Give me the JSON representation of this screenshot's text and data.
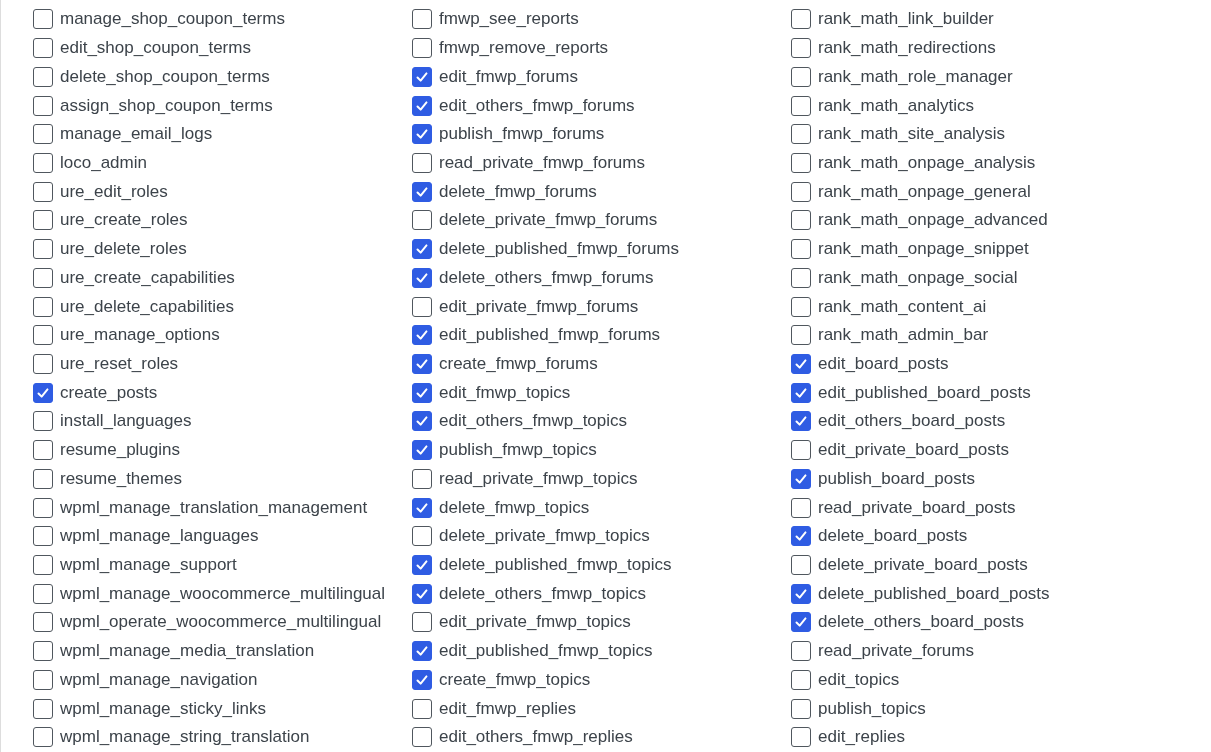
{
  "columns": [
    [
      {
        "label": "manage_shop_coupon_terms",
        "checked": false
      },
      {
        "label": "edit_shop_coupon_terms",
        "checked": false
      },
      {
        "label": "delete_shop_coupon_terms",
        "checked": false
      },
      {
        "label": "assign_shop_coupon_terms",
        "checked": false
      },
      {
        "label": "manage_email_logs",
        "checked": false
      },
      {
        "label": "loco_admin",
        "checked": false
      },
      {
        "label": "ure_edit_roles",
        "checked": false
      },
      {
        "label": "ure_create_roles",
        "checked": false
      },
      {
        "label": "ure_delete_roles",
        "checked": false
      },
      {
        "label": "ure_create_capabilities",
        "checked": false
      },
      {
        "label": "ure_delete_capabilities",
        "checked": false
      },
      {
        "label": "ure_manage_options",
        "checked": false
      },
      {
        "label": "ure_reset_roles",
        "checked": false
      },
      {
        "label": "create_posts",
        "checked": true
      },
      {
        "label": "install_languages",
        "checked": false
      },
      {
        "label": "resume_plugins",
        "checked": false
      },
      {
        "label": "resume_themes",
        "checked": false
      },
      {
        "label": "wpml_manage_translation_management",
        "checked": false
      },
      {
        "label": "wpml_manage_languages",
        "checked": false
      },
      {
        "label": "wpml_manage_support",
        "checked": false
      },
      {
        "label": "wpml_manage_woocommerce_multilingual",
        "checked": false
      },
      {
        "label": "wpml_operate_woocommerce_multilingual",
        "checked": false
      },
      {
        "label": "wpml_manage_media_translation",
        "checked": false
      },
      {
        "label": "wpml_manage_navigation",
        "checked": false
      },
      {
        "label": "wpml_manage_sticky_links",
        "checked": false
      },
      {
        "label": "wpml_manage_string_translation",
        "checked": false
      }
    ],
    [
      {
        "label": "fmwp_see_reports",
        "checked": false
      },
      {
        "label": "fmwp_remove_reports",
        "checked": false
      },
      {
        "label": "edit_fmwp_forums",
        "checked": true
      },
      {
        "label": "edit_others_fmwp_forums",
        "checked": true
      },
      {
        "label": "publish_fmwp_forums",
        "checked": true
      },
      {
        "label": "read_private_fmwp_forums",
        "checked": false
      },
      {
        "label": "delete_fmwp_forums",
        "checked": true
      },
      {
        "label": "delete_private_fmwp_forums",
        "checked": false
      },
      {
        "label": "delete_published_fmwp_forums",
        "checked": true
      },
      {
        "label": "delete_others_fmwp_forums",
        "checked": true
      },
      {
        "label": "edit_private_fmwp_forums",
        "checked": false
      },
      {
        "label": "edit_published_fmwp_forums",
        "checked": true
      },
      {
        "label": "create_fmwp_forums",
        "checked": true
      },
      {
        "label": "edit_fmwp_topics",
        "checked": true
      },
      {
        "label": "edit_others_fmwp_topics",
        "checked": true
      },
      {
        "label": "publish_fmwp_topics",
        "checked": true
      },
      {
        "label": "read_private_fmwp_topics",
        "checked": false
      },
      {
        "label": "delete_fmwp_topics",
        "checked": true
      },
      {
        "label": "delete_private_fmwp_topics",
        "checked": false
      },
      {
        "label": "delete_published_fmwp_topics",
        "checked": true
      },
      {
        "label": "delete_others_fmwp_topics",
        "checked": true
      },
      {
        "label": "edit_private_fmwp_topics",
        "checked": false
      },
      {
        "label": "edit_published_fmwp_topics",
        "checked": true
      },
      {
        "label": "create_fmwp_topics",
        "checked": true
      },
      {
        "label": "edit_fmwp_replies",
        "checked": false
      },
      {
        "label": "edit_others_fmwp_replies",
        "checked": false
      }
    ],
    [
      {
        "label": "rank_math_link_builder",
        "checked": false
      },
      {
        "label": "rank_math_redirections",
        "checked": false
      },
      {
        "label": "rank_math_role_manager",
        "checked": false
      },
      {
        "label": "rank_math_analytics",
        "checked": false
      },
      {
        "label": "rank_math_site_analysis",
        "checked": false
      },
      {
        "label": "rank_math_onpage_analysis",
        "checked": false
      },
      {
        "label": "rank_math_onpage_general",
        "checked": false
      },
      {
        "label": "rank_math_onpage_advanced",
        "checked": false
      },
      {
        "label": "rank_math_onpage_snippet",
        "checked": false
      },
      {
        "label": "rank_math_onpage_social",
        "checked": false
      },
      {
        "label": "rank_math_content_ai",
        "checked": false
      },
      {
        "label": "rank_math_admin_bar",
        "checked": false
      },
      {
        "label": "edit_board_posts",
        "checked": true
      },
      {
        "label": "edit_published_board_posts",
        "checked": true
      },
      {
        "label": "edit_others_board_posts",
        "checked": true
      },
      {
        "label": "edit_private_board_posts",
        "checked": false
      },
      {
        "label": "publish_board_posts",
        "checked": true
      },
      {
        "label": "read_private_board_posts",
        "checked": false
      },
      {
        "label": "delete_board_posts",
        "checked": true
      },
      {
        "label": "delete_private_board_posts",
        "checked": false
      },
      {
        "label": "delete_published_board_posts",
        "checked": true
      },
      {
        "label": "delete_others_board_posts",
        "checked": true
      },
      {
        "label": "read_private_forums",
        "checked": false
      },
      {
        "label": "edit_topics",
        "checked": false
      },
      {
        "label": "publish_topics",
        "checked": false
      },
      {
        "label": "edit_replies",
        "checked": false
      }
    ]
  ]
}
